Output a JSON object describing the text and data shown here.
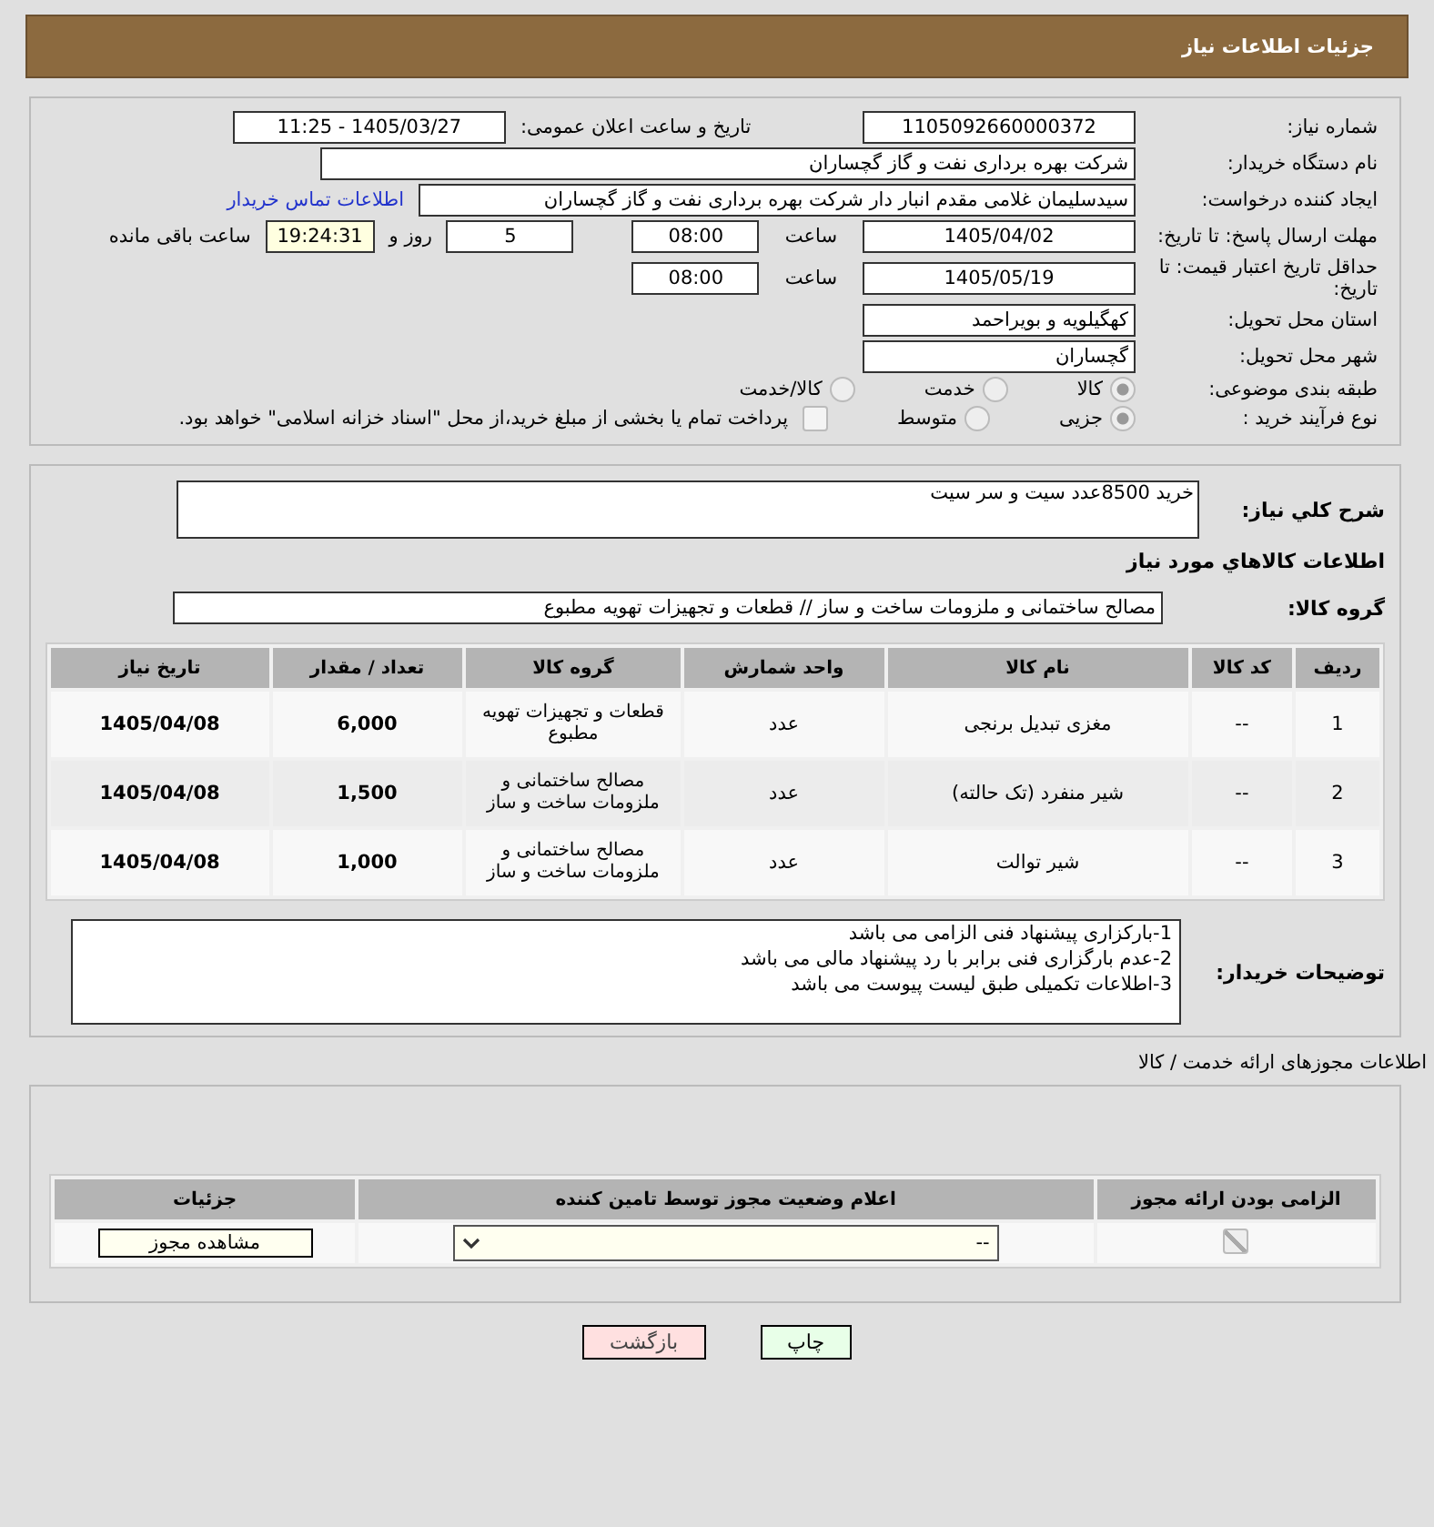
{
  "header": {
    "title": "جزئیات اطلاعات نیاز"
  },
  "form": {
    "need_number": {
      "label": "شماره نیاز:",
      "value": "1105092660000372"
    },
    "announce": {
      "label": "تاریخ و ساعت اعلان عمومی:",
      "value": "1405/03/27 - 11:25"
    },
    "buyer": {
      "label": "نام دستگاه خریدار:",
      "value": "شرکت بهره برداری نفت و گاز گچساران"
    },
    "requester": {
      "label": "ایجاد کننده درخواست:",
      "value": "سیدسلیمان غلامی مقدم انبار دار شرکت بهره برداری نفت و گاز گچساران",
      "link": "اطلاعات تماس خریدار"
    },
    "deadline": {
      "label": "مهلت ارسال پاسخ: تا تاریخ:",
      "date": "1405/04/02",
      "time_label": "ساعت",
      "time": "08:00",
      "days": "5",
      "days_label": "روز و",
      "remaining": "19:24:31",
      "remaining_label": "ساعت باقی مانده"
    },
    "validity": {
      "label": "حداقل تاریخ اعتبار قیمت: تا تاریخ:",
      "date": "1405/05/19",
      "time_label": "ساعت",
      "time": "08:00"
    },
    "province": {
      "label": "استان محل تحویل:",
      "value": "کهگیلویه و بویراحمد"
    },
    "city": {
      "label": "شهر محل تحویل:",
      "value": "گچساران"
    },
    "category": {
      "label": "طبقه بندی موضوعی:",
      "options": [
        {
          "label": "کالا",
          "selected": true
        },
        {
          "label": "خدمت",
          "selected": false
        },
        {
          "label": "کالا/خدمت",
          "selected": false
        }
      ]
    },
    "process": {
      "label": "نوع فرآیند خرید :",
      "options": [
        {
          "label": "جزیی",
          "selected": true
        },
        {
          "label": "متوسط",
          "selected": false
        }
      ],
      "payment": {
        "label": "پرداخت تمام یا بخشی از مبلغ خرید،از محل \"اسناد خزانه اسلامی\" خواهد بود.",
        "checked": false
      }
    }
  },
  "summary": {
    "label": "شرح کلي نیاز:",
    "value": "خرید 8500عدد سیت و سر سیت"
  },
  "goods_title": "اطلاعات کالاهاي مورد نیاز",
  "goods_group": {
    "label": "گروه کالا:",
    "value": "مصالح ساختمانی و ملزومات ساخت و ساز //  قطعات و تجهیزات تهویه مطبوع"
  },
  "goods_table": {
    "columns": [
      "ردیف",
      "کد کالا",
      "نام کالا",
      "واحد شمارش",
      "گروه کالا",
      "تعداد / مقدار",
      "تاریخ نیاز"
    ],
    "rows": [
      [
        "1",
        "--",
        "مغزی تبدیل برنجی",
        "عدد",
        "قطعات و تجهیزات تهویه مطبوع",
        "6,000",
        "1405/04/08"
      ],
      [
        "2",
        "--",
        "شیر منفرد (تک حالته)",
        "عدد",
        "مصالح ساختمانی و ملزومات ساخت و ساز",
        "1,500",
        "1405/04/08"
      ],
      [
        "3",
        "--",
        "شیر توالت",
        "عدد",
        "مصالح ساختمانی و ملزومات ساخت و ساز",
        "1,000",
        "1405/04/08"
      ]
    ]
  },
  "buyer_notes": {
    "label": "توضیحات خریدار:",
    "lines": [
      "1-بارکزاری پیشنهاد فنی الزامی می باشد",
      "2-عدم بارگزاری فنی برابر با رد پیشنهاد مالی می باشد",
      "3-اطلاعات تکمیلی طبق لیست پیوست می باشد"
    ]
  },
  "licenses": {
    "title": "اطلاعات مجوزهای ارائه خدمت / کالا",
    "columns": [
      "الزامی بودن ارائه مجوز",
      "اعلام وضعیت مجوز توسط تامین کننده",
      "جزئیات"
    ],
    "rows": [
      {
        "required": true,
        "status": "--",
        "button": "مشاهده مجوز"
      }
    ]
  },
  "buttons": [
    {
      "kind": "print",
      "label": "چاپ"
    },
    {
      "kind": "back",
      "label": "بازگشت"
    }
  ]
}
